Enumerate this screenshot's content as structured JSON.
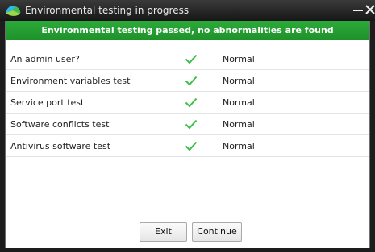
{
  "window": {
    "title": "Environmental testing in progress",
    "minimize_icon": "minimize-icon",
    "close_icon": "close-icon"
  },
  "banner": {
    "text": "Environmental testing passed, no abnormalities are found",
    "color": "#22a030"
  },
  "checks": [
    {
      "label": "An admin user?",
      "icon": "checkmark-icon",
      "status": "Normal"
    },
    {
      "label": "Environment variables test",
      "icon": "checkmark-icon",
      "status": "Normal"
    },
    {
      "label": "Service port test",
      "icon": "checkmark-icon",
      "status": "Normal"
    },
    {
      "label": "Software conflicts test",
      "icon": "checkmark-icon",
      "status": "Normal"
    },
    {
      "label": "Antivirus software test",
      "icon": "checkmark-icon",
      "status": "Normal"
    }
  ],
  "buttons": {
    "exit": "Exit",
    "continue": "Continue"
  },
  "colors": {
    "check": "#3cc04a",
    "titlebar": "#1d1d1d"
  }
}
